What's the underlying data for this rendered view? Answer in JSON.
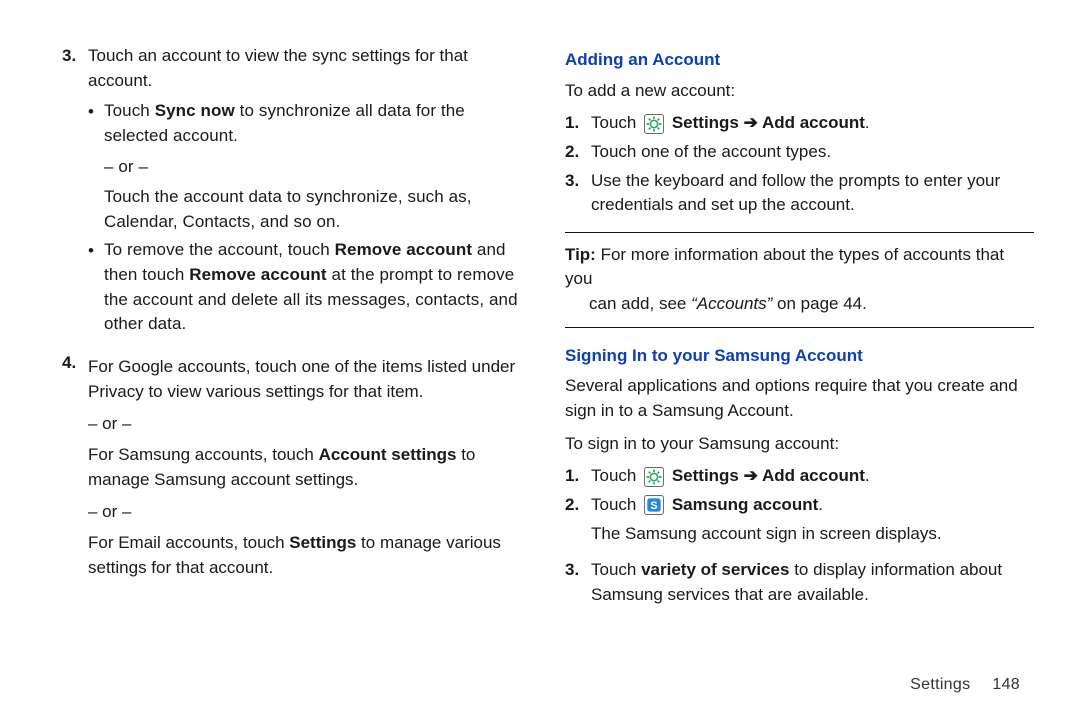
{
  "left": {
    "item3_num": "3.",
    "item3_text": "Touch an account to view the sync settings for that account.",
    "b1_pre": "Touch ",
    "b1_bold": "Sync now",
    "b1_post": " to synchronize all data for the selected account.",
    "or1": "– or –",
    "b1_alt": "Touch the account data to synchronize, such as, Calendar, Contacts, and so on.",
    "b2_pre": "To remove the account, touch ",
    "b2_bold1": "Remove account",
    "b2_mid": " and then touch ",
    "b2_bold2": "Remove account",
    "b2_post": " at the prompt to remove the account and delete all its messages, contacts, and other data.",
    "item4_num": "4.",
    "item4_text": "For Google accounts, touch one of the items listed under Privacy to view various settings for that item.",
    "or2": "– or –",
    "item4_alt1_pre": "For Samsung accounts, touch ",
    "item4_alt1_bold": "Account settings",
    "item4_alt1_post": " to manage Samsung account settings.",
    "or3": "– or –",
    "item4_alt2_pre": "For Email accounts, touch ",
    "item4_alt2_bold": "Settings",
    "item4_alt2_post": " to manage various settings for that account."
  },
  "right": {
    "heading1": "Adding an Account",
    "intro1": "To add a new account:",
    "s1_num": "1.",
    "s1_pre": "Touch ",
    "s1_bold": "Settings ➔ Add account",
    "s1_post": ".",
    "s2_num": "2.",
    "s2_text": "Touch one of the account types.",
    "s3_num": "3.",
    "s3_text": "Use the keyboard and follow the prompts to enter your credentials and set up the account.",
    "tip_label": "Tip:",
    "tip_line1": " For more information about the types of accounts that you",
    "tip_line2_pre": "can add, see ",
    "tip_line2_ital": "“Accounts”",
    "tip_line2_post": " on page 44.",
    "heading2": "Signing In to your Samsung Account",
    "intro2a": "Several applications and options require that you create and sign in to a Samsung Account.",
    "intro2b": "To sign in to your Samsung account:",
    "t1_num": "1.",
    "t1_pre": "Touch ",
    "t1_bold": "Settings ➔ Add account",
    "t1_post": ".",
    "t2_num": "2.",
    "t2_pre": "Touch ",
    "t2_bold": "Samsung account",
    "t2_post": ".",
    "t2_desc": "The Samsung account sign in screen displays.",
    "t3_num": "3.",
    "t3_pre": "Touch ",
    "t3_bold": "variety of services",
    "t3_post": " to display information about Samsung services that are available."
  },
  "footer": {
    "label": "Settings",
    "page": "148"
  }
}
